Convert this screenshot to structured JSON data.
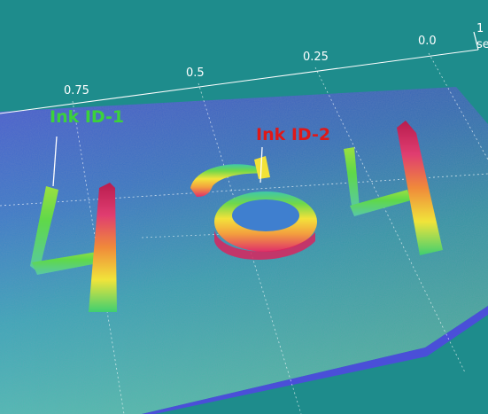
{
  "chart_data": {
    "type": "surface-3d",
    "x_axis": {
      "ticks": [
        "0.75",
        "0.5",
        "0.25",
        "0.0"
      ],
      "edge_labels": [
        "1",
        "se"
      ]
    },
    "annotations": [
      {
        "label": "Ink ID-1",
        "color": "#3bd23b"
      },
      {
        "label": "Ink ID-2",
        "color": "#e01818"
      }
    ],
    "surface": {
      "description_shown": "embossed handwritten digits on paper surface",
      "digits_shown": [
        "4",
        "9",
        "4"
      ]
    },
    "colors": {
      "background": "#1e8c8c",
      "surface_low": "#3a4fc8",
      "surface_mid": "#3fb7b0",
      "peak_green": "#49d84a",
      "peak_yellow": "#f2e238",
      "peak_red": "#d8255e",
      "grid": "#ffffff"
    }
  }
}
